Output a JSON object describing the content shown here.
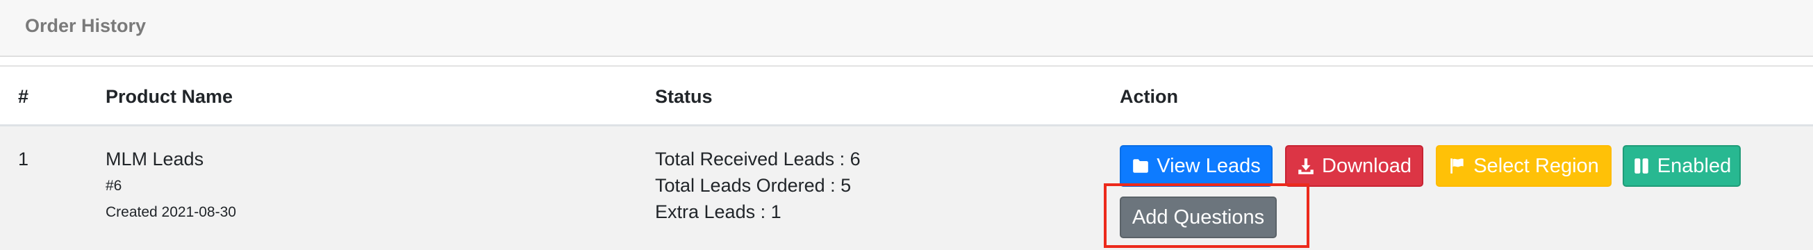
{
  "card": {
    "title": "Order History"
  },
  "table": {
    "headers": [
      "#",
      "Product Name",
      "Status",
      "Action"
    ],
    "rows": [
      {
        "number": "1",
        "product_name": "MLM Leads",
        "product_id": "#6",
        "created": "Created 2021-08-30",
        "status_lines": [
          "Total Received Leads : 6",
          "Total Leads Ordered : 5",
          "Extra Leads : 1"
        ],
        "actions": {
          "view_leads": "View Leads",
          "download": "Download",
          "select_region": "Select Region",
          "enabled": "Enabled",
          "add_questions": "Add Questions"
        }
      }
    ]
  },
  "colors": {
    "primary": "#0d7bff",
    "danger": "#dc3545",
    "warning": "#ffc107",
    "success": "#28b891",
    "secondary": "#6c757d",
    "highlight": "#ec2a1c"
  },
  "icons": {
    "view_leads": "folder-icon",
    "download": "download-icon",
    "select_region": "flag-icon",
    "enabled": "columns-icon"
  }
}
